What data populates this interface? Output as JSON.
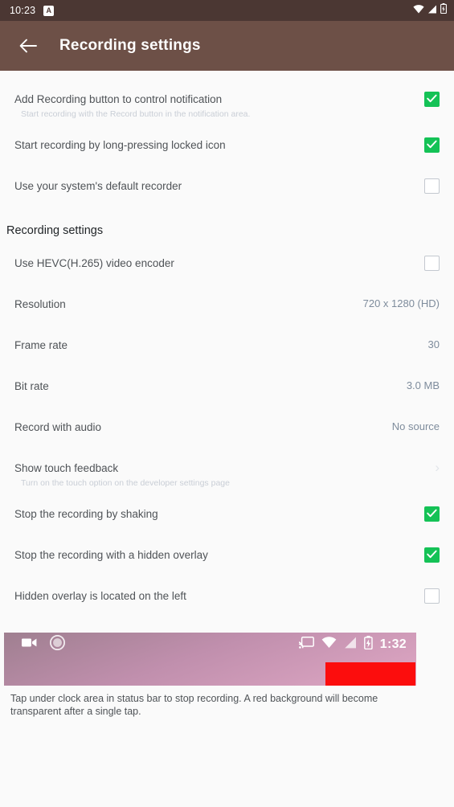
{
  "system_status_bar": {
    "clock": "10:23",
    "badge_label": "A",
    "icons": [
      "wifi-icon",
      "cellular-signal-icon",
      "battery-icon"
    ]
  },
  "app_bar": {
    "back_icon": "back-arrow-icon",
    "title": "Recording settings"
  },
  "general_settings": [
    {
      "title": "Add Recording button to control notification",
      "subtitle": "Start recording with the Record button in the notification area.",
      "control": "checkbox",
      "checked": true
    },
    {
      "title": "Start recording by long-pressing locked icon",
      "subtitle": "",
      "control": "checkbox",
      "checked": true
    },
    {
      "title": "Use your system's default recorder",
      "subtitle": "",
      "control": "checkbox",
      "checked": false
    }
  ],
  "section": {
    "header": "Recording settings",
    "rows": [
      {
        "title": "Use HEVC(H.265) video encoder",
        "subtitle": "",
        "control": "checkbox",
        "checked": false,
        "value": ""
      },
      {
        "title": "Resolution",
        "subtitle": "",
        "control": "value",
        "checked": false,
        "value": "720 x 1280 (HD)"
      },
      {
        "title": "Frame rate",
        "subtitle": "",
        "control": "value",
        "checked": false,
        "value": "30"
      },
      {
        "title": "Bit rate",
        "subtitle": "",
        "control": "value",
        "checked": false,
        "value": "3.0 MB"
      },
      {
        "title": "Record with audio",
        "subtitle": "",
        "control": "value",
        "checked": false,
        "value": "No source"
      },
      {
        "title": "Show touch feedback",
        "subtitle": "Turn on the touch option on the developer settings page",
        "control": "chevron",
        "checked": false,
        "value": ""
      },
      {
        "title": "Stop the recording by shaking",
        "subtitle": "",
        "control": "checkbox",
        "checked": true,
        "value": ""
      },
      {
        "title": "Stop the recording with a hidden overlay",
        "subtitle": "",
        "control": "checkbox",
        "checked": true,
        "value": ""
      },
      {
        "title": "Hidden overlay is located on the left",
        "subtitle": "",
        "control": "checkbox",
        "checked": false,
        "value": ""
      }
    ]
  },
  "preview": {
    "left_icons": [
      "video-camera-icon",
      "record-circle-icon"
    ],
    "right_icons": [
      "cast-icon",
      "wifi-icon",
      "cellular-signal-icon",
      "battery-charging-icon"
    ],
    "clock": "1:32",
    "red_block_color": "#fc0d0d",
    "caption": "Tap under clock area in status bar to stop recording. A red background will become transparent after a single tap."
  },
  "colors": {
    "status_bar_bg": "#4b3733",
    "app_bar_bg": "#6d5047",
    "checkbox_on": "#14c256",
    "value_text": "#7e8c9c",
    "page_bg": "#fafafa"
  }
}
